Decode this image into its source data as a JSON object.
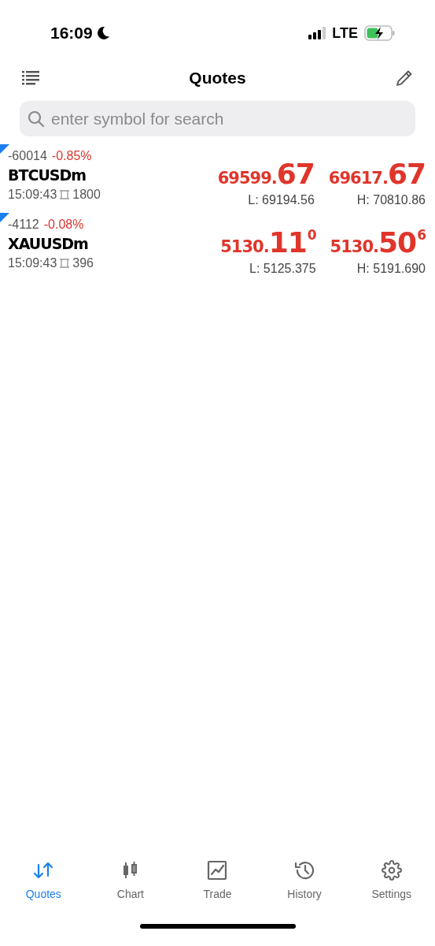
{
  "status_bar": {
    "time": "16:09",
    "network": "LTE"
  },
  "header": {
    "title": "Quotes"
  },
  "search": {
    "placeholder": "enter symbol for search"
  },
  "quotes": [
    {
      "change": "-60014",
      "change_percent": "-0.85%",
      "symbol": "BTCUSDm",
      "time": "15:09:43",
      "spread": "1800",
      "bid": {
        "prefix": "69599.",
        "big": "67"
      },
      "ask": {
        "prefix": "69617.",
        "big": "67"
      },
      "low": "L: 69194.56",
      "high": "H: 70810.86"
    },
    {
      "change": "-4112",
      "change_percent": "-0.08%",
      "symbol": "XAUUSDm",
      "time": "15:09:43",
      "spread": "396",
      "bid": {
        "prefix": "5130.",
        "big": "11",
        "sup": "0"
      },
      "ask": {
        "prefix": "5130.",
        "big": "50",
        "sup": "6"
      },
      "low": "L: 5125.375",
      "high": "H: 5191.690"
    }
  ],
  "tabs": [
    {
      "kind": "quotes",
      "label": "Quotes",
      "selected": true
    },
    {
      "kind": "chart",
      "label": "Chart",
      "selected": false
    },
    {
      "kind": "trade",
      "label": "Trade",
      "selected": false
    },
    {
      "kind": "history",
      "label": "History",
      "selected": false
    },
    {
      "kind": "settings",
      "label": "Settings",
      "selected": false
    }
  ]
}
